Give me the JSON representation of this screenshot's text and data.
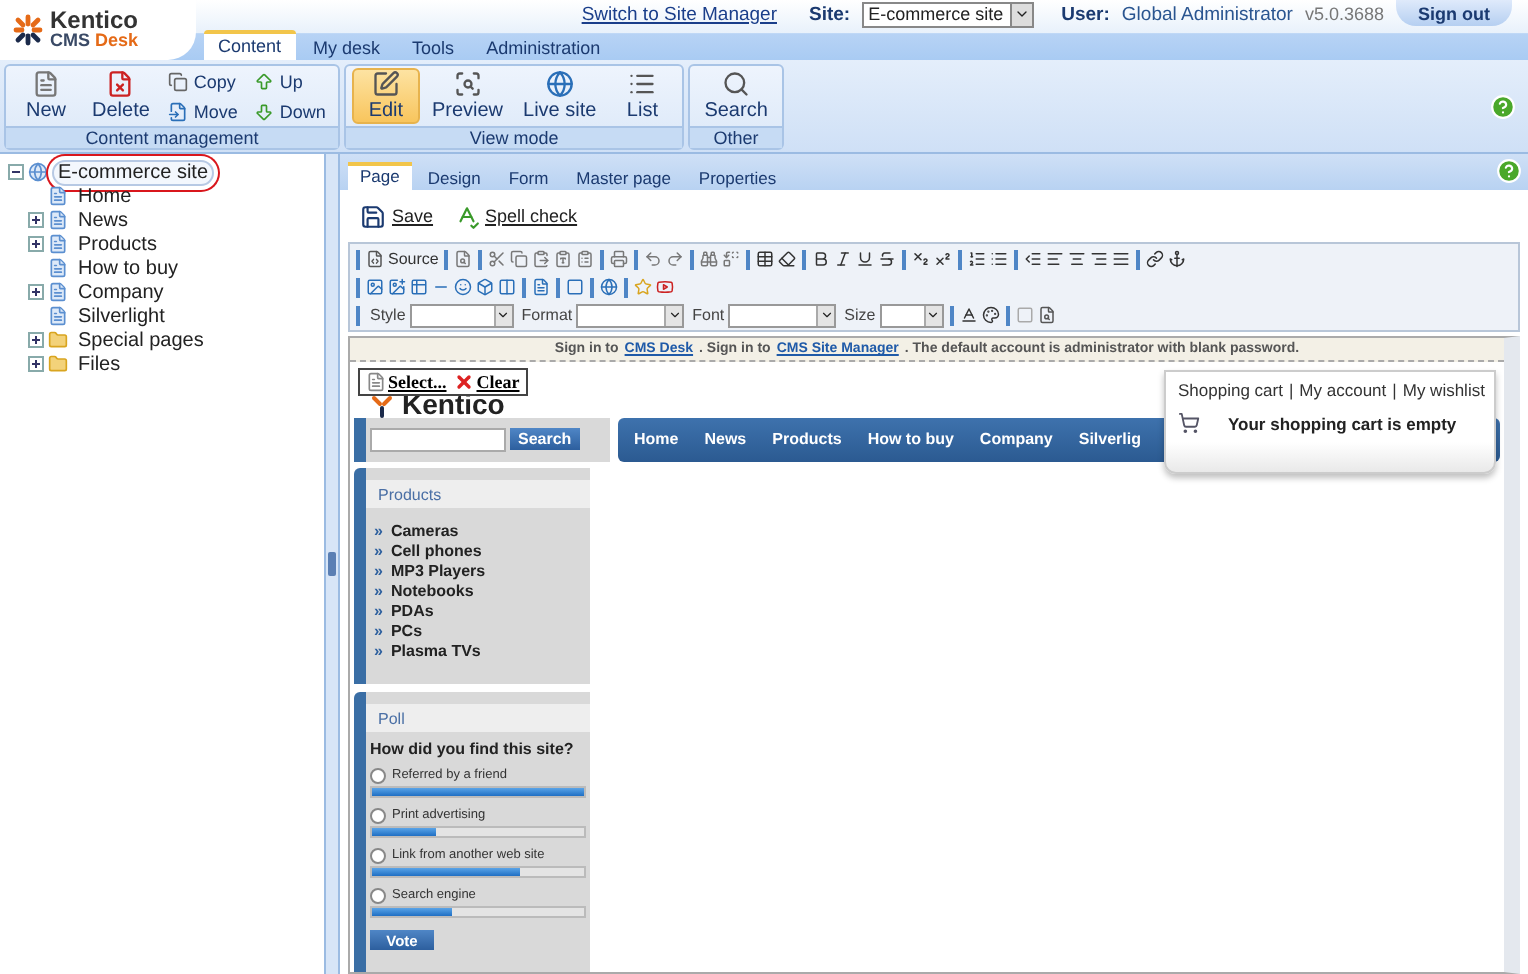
{
  "header": {
    "logo": {
      "name": "Kentico",
      "product": "CMS",
      "edition": "Desk"
    },
    "tabs": [
      {
        "label": "Content",
        "selected": true
      },
      {
        "label": "My desk",
        "selected": false
      },
      {
        "label": "Tools",
        "selected": false
      },
      {
        "label": "Administration",
        "selected": false
      }
    ],
    "switch_link": "Switch to Site Manager",
    "site_label": "Site:",
    "site_value": "E-commerce site",
    "user_label": "User:",
    "user_name": "Global Administrator",
    "version": "v5.0.3688",
    "sign_out": "Sign out"
  },
  "toolbar": {
    "groups": [
      {
        "title": "Content management",
        "buttons": [
          {
            "label": "New",
            "kind": "large",
            "selected": false
          },
          {
            "label": "Delete",
            "kind": "large",
            "selected": false
          },
          {
            "label": "Copy",
            "kind": "small",
            "selected": false
          },
          {
            "label": "Move",
            "kind": "small",
            "selected": false
          },
          {
            "label": "Up",
            "kind": "small",
            "selected": false
          },
          {
            "label": "Down",
            "kind": "small",
            "selected": false
          }
        ]
      },
      {
        "title": "View mode",
        "buttons": [
          {
            "label": "Edit",
            "kind": "large",
            "selected": true
          },
          {
            "label": "Preview",
            "kind": "large",
            "selected": false
          },
          {
            "label": "Live site",
            "kind": "large",
            "selected": false
          },
          {
            "label": "List",
            "kind": "large",
            "selected": false
          }
        ]
      },
      {
        "title": "Other",
        "buttons": [
          {
            "label": "Search",
            "kind": "large",
            "selected": false
          }
        ]
      }
    ]
  },
  "tree": {
    "items": [
      {
        "label": "E-commerce site",
        "kind": "site",
        "expanded": true,
        "selected": true,
        "circled": true,
        "children": [
          {
            "label": "Home",
            "kind": "page",
            "selected": false,
            "circled": false
          },
          {
            "label": "News",
            "kind": "page",
            "expanded": false,
            "selected": false,
            "circled": false
          },
          {
            "label": "Products",
            "kind": "page",
            "expanded": false,
            "selected": false,
            "circled": false
          },
          {
            "label": "How to buy",
            "kind": "page",
            "selected": false,
            "circled": false
          },
          {
            "label": "Company",
            "kind": "page",
            "expanded": false,
            "selected": false,
            "circled": false
          },
          {
            "label": "Silverlight",
            "kind": "page",
            "selected": false,
            "circled": false
          },
          {
            "label": "Special pages",
            "kind": "folder",
            "expanded": false,
            "selected": false,
            "circled": false
          },
          {
            "label": "Files",
            "kind": "folder",
            "expanded": false,
            "selected": false,
            "circled": false
          }
        ]
      }
    ]
  },
  "editor": {
    "tabs": [
      {
        "label": "Page",
        "selected": true
      },
      {
        "label": "Design",
        "selected": false
      },
      {
        "label": "Form",
        "selected": false
      },
      {
        "label": "Master page",
        "selected": false
      },
      {
        "label": "Properties",
        "selected": false
      }
    ],
    "actions": [
      "Save",
      "Spell check"
    ],
    "source_label": "Source",
    "selects": [
      {
        "label": "Style"
      },
      {
        "label": "Format"
      },
      {
        "label": "Font"
      },
      {
        "label": "Size"
      }
    ]
  },
  "page": {
    "notice": [
      {
        "kind": "text",
        "text": "Sign in to"
      },
      {
        "kind": "link",
        "text": "CMS Desk"
      },
      {
        "kind": "text",
        "text": ". Sign in to"
      },
      {
        "kind": "link",
        "text": "CMS Site Manager"
      },
      {
        "kind": "text",
        "text": ". The default account is administrator with blank password."
      }
    ],
    "logo_text": "Kentico",
    "webpart_actions": [
      "Select...",
      "Clear"
    ],
    "search_button": "Search",
    "nav": [
      "Home",
      "News",
      "Products",
      "How to buy",
      "Company",
      "Silverlig"
    ],
    "cart": {
      "links": [
        "Shopping cart",
        "My account",
        "My wishlist"
      ],
      "separator": "|",
      "message": "Your shopping cart is empty"
    },
    "products": {
      "title": "Products",
      "bullet": "»",
      "items": [
        "Cameras",
        "Cell phones",
        "MP3 Players",
        "Notebooks",
        "PDAs",
        "PCs",
        "Plasma TVs"
      ]
    },
    "poll": {
      "title": "Poll",
      "question": "How did you find this site?",
      "options": [
        {
          "label": "Referred by a friend",
          "selected": false,
          "level": 1.0
        },
        {
          "label": "Print advertising",
          "selected": false,
          "level": 0.3
        },
        {
          "label": "Link from another web site",
          "selected": false,
          "level": 0.7
        },
        {
          "label": "Search engine",
          "selected": false,
          "level": 0.38
        }
      ],
      "vote": "Vote"
    }
  }
}
